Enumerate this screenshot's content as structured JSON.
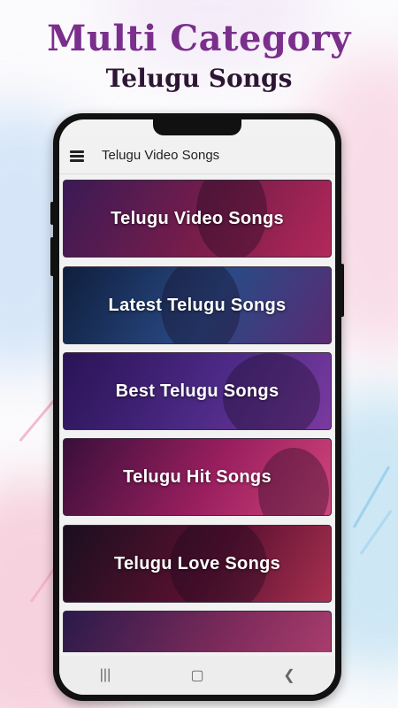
{
  "promo": {
    "headline": "Multi Category",
    "subheadline": "Telugu Songs"
  },
  "app": {
    "title": "Telugu Video Songs",
    "menu_icon": "hamburger-menu-icon"
  },
  "categories": [
    {
      "label": "Telugu Video Songs",
      "colors": [
        "#3a1a55",
        "#7a1d4a",
        "#b3285a"
      ]
    },
    {
      "label": "Latest Telugu Songs",
      "colors": [
        "#0f1f3d",
        "#2a4a86",
        "#5a2a72"
      ]
    },
    {
      "label": "Best Telugu Songs",
      "colors": [
        "#2a1356",
        "#4c2a86",
        "#7a3aa0"
      ]
    },
    {
      "label": "Telugu Hit Songs",
      "colors": [
        "#3a0f3a",
        "#9a1f5f",
        "#d0457a"
      ]
    },
    {
      "label": "Telugu Love Songs",
      "colors": [
        "#1a0f1f",
        "#5a1030",
        "#a83050"
      ]
    },
    {
      "label": "",
      "colors": [
        "#2a1a4a",
        "#7a2a5a",
        "#b04070"
      ]
    }
  ],
  "navigation": {
    "recents_icon": "recents-icon",
    "home_icon": "home-icon",
    "back_icon": "back-icon"
  }
}
